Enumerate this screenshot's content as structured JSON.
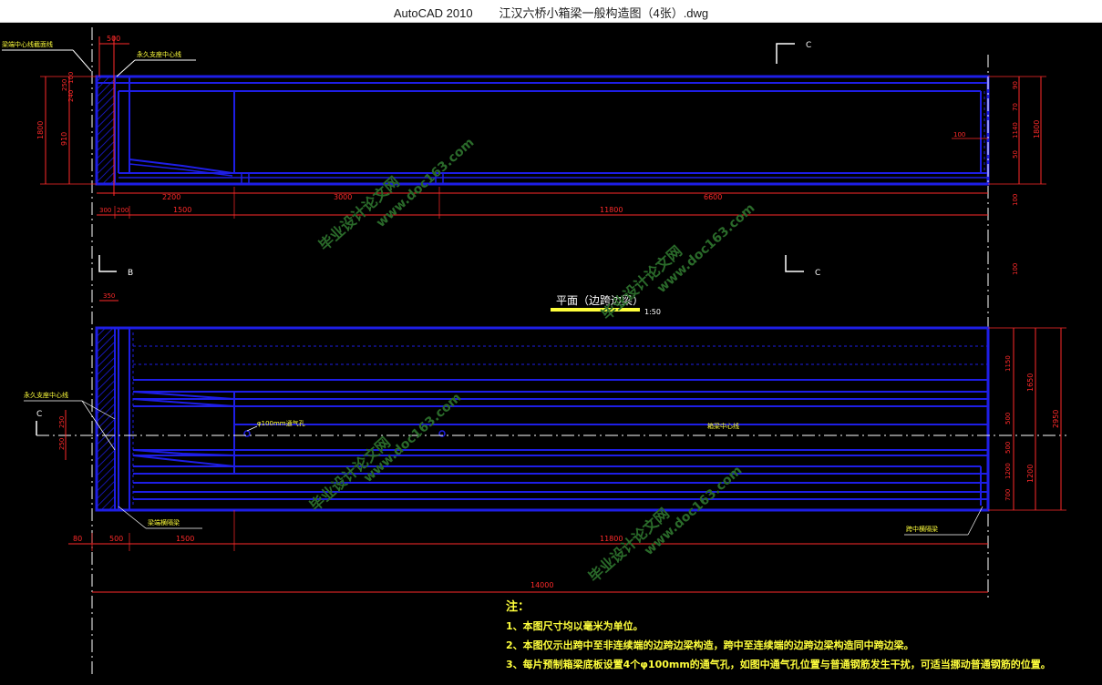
{
  "window": {
    "app": "AutoCAD 2010",
    "file": "江汉六桥小箱梁一般构造图（4张）.dwg"
  },
  "colors": {
    "background": "#000000",
    "beam": "#1e1ee6",
    "dimension": "#ff2a2a",
    "annotation": "#ffff3c",
    "text_white": "#ffffff",
    "watermark": "#2a6a2a"
  },
  "elevation": {
    "section_mark_top": "C",
    "section_mark_b": "B",
    "section_mark_c2": "C",
    "label_support_center": "梁端中心线截面线",
    "label_permanent_support": "永久支座中心线",
    "dims_top": [
      "500"
    ],
    "dims_left": [
      "1800",
      "910",
      "250",
      "240",
      "100"
    ],
    "dims_right": [
      "90",
      "70",
      "1140",
      "50",
      "100",
      "1800",
      "100"
    ],
    "dim_inner_right": "100",
    "dims_bottom_row1": [
      "2200",
      "3000",
      "6600"
    ],
    "dims_bottom_row2": [
      "300",
      "200",
      "1500",
      "11800"
    ]
  },
  "plan": {
    "title": "平面（边跨边梁）",
    "scale": "1:50",
    "label_permanent_support": "永久支座中心线",
    "label_vent": "φ100mm通气孔",
    "label_centerline": "箱梁中心线",
    "label_end_beam": "梁端横隔梁",
    "label_midspan": "跨中横隔梁",
    "section_mark_c": "C",
    "dim_top": "350",
    "dims_left": [
      "250",
      "250"
    ],
    "dims_right_inner": [
      "1150",
      "500",
      "500",
      "1200",
      "700"
    ],
    "dims_right_mid": [
      "1650",
      "1200"
    ],
    "dim_right_outer": "2950",
    "dims_bottom": [
      "80",
      "500",
      "1500",
      "11800"
    ],
    "dim_total": "14000"
  },
  "notes": {
    "heading": "注：",
    "items": [
      "1、本图尺寸均以毫米为单位。",
      "2、本图仅示出跨中至非连续端的边跨边梁构造，跨中至连续端的边跨边梁构造同中跨边梁。",
      "3、每片预制箱梁底板设置4个φ100mm的通气孔，如图中通气孔位置与普通钢筋发生干扰，可适当挪动普通钢筋的位置。"
    ]
  },
  "watermark": {
    "text1": "毕业设计论文网",
    "text2": "www.doc163.com"
  }
}
